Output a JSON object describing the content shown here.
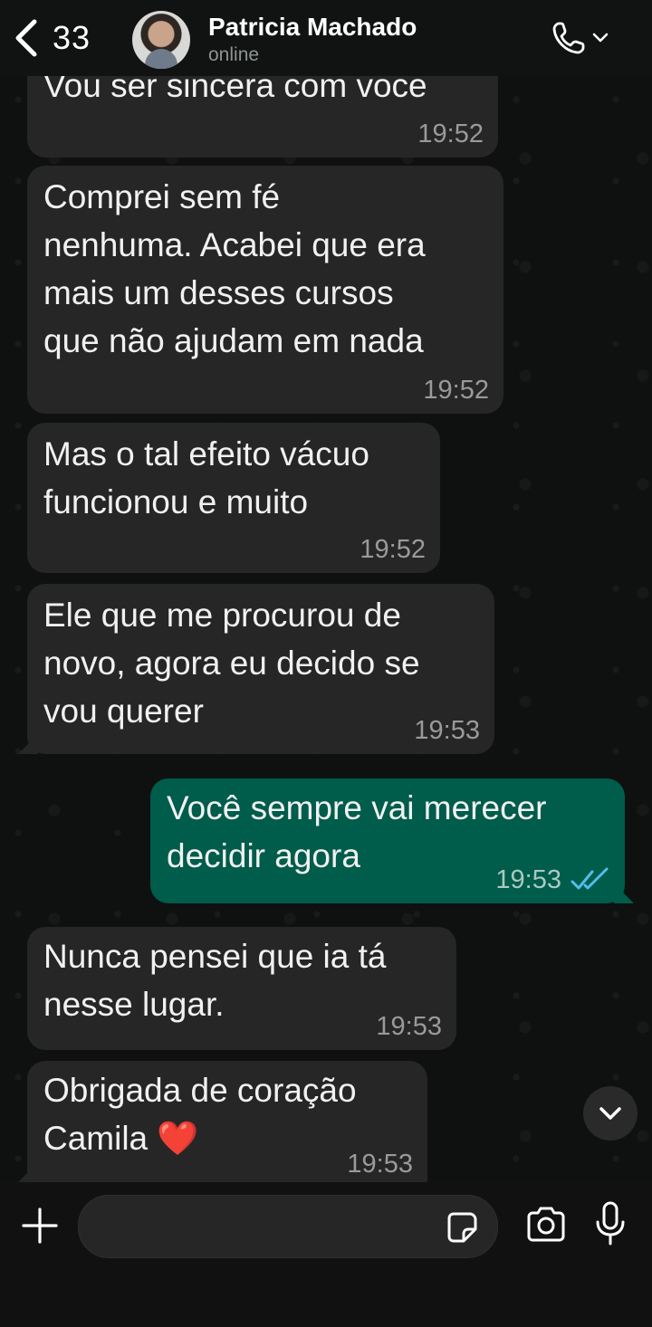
{
  "header": {
    "back_count": "33",
    "contact_name": "Patricia Machado",
    "status": "online"
  },
  "messages": [
    {
      "direction": "in",
      "text": "Vou ser sincera com voce",
      "time": "19:52"
    },
    {
      "direction": "in",
      "text": "Comprei sem fé\nnenhuma. Acabei que era\nmais um desses cursos\nque não ajudam em nada",
      "time": "19:52"
    },
    {
      "direction": "in",
      "text": "Mas o tal efeito vácuo\nfuncionou e muito",
      "time": "19:52"
    },
    {
      "direction": "in",
      "text": "Ele que me procurou de\nnovo, agora eu decido se\nvou querer",
      "time": "19:53"
    },
    {
      "direction": "out",
      "text": "Você sempre vai merecer\ndecidir agora",
      "time": "19:53",
      "status": "read"
    },
    {
      "direction": "in",
      "text": "Nunca pensei que ia tá\nnesse lugar.",
      "time": "19:53"
    },
    {
      "direction": "in",
      "text": "Obrigada de coração\nCamila ❤️",
      "time": "19:53"
    }
  ],
  "composer": {
    "placeholder": ""
  },
  "colors": {
    "incoming_bubble": "#262626",
    "outgoing_bubble": "#005c4b",
    "read_ticks": "#53bdeb"
  },
  "icons": [
    "chevron-left-icon",
    "phone-icon",
    "chevron-down-icon",
    "plus-icon",
    "sticker-icon",
    "camera-icon",
    "mic-icon"
  ]
}
